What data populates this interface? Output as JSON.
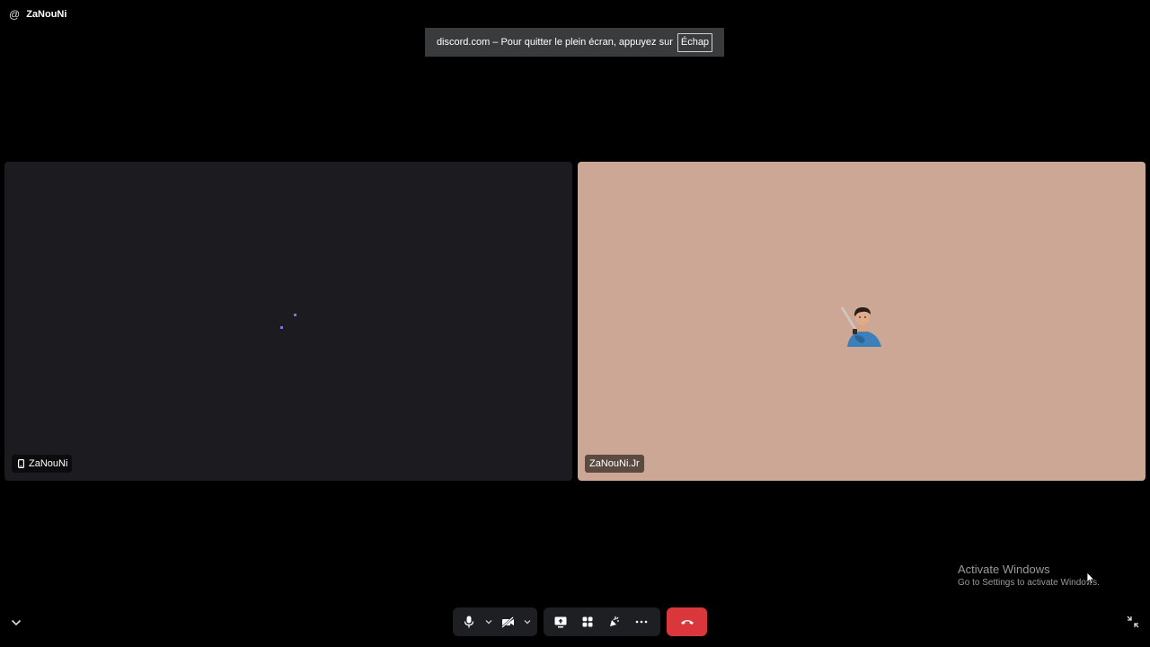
{
  "header": {
    "at_icon": "@",
    "channel_name": "ZaNouNi"
  },
  "fullscreen_banner": {
    "message": "discord.com – Pour quitter le plein écran, appuyez sur",
    "key": "Échap"
  },
  "tiles": [
    {
      "name": "ZaNouNi",
      "icon": "phone-icon",
      "background": "#1c1c20",
      "state": "loading"
    },
    {
      "name": "ZaNouNi.Jr",
      "icon": "avatar",
      "background": "#cca795"
    }
  ],
  "watermark": {
    "title": "Activate Windows",
    "subtitle": "Go to Settings to activate Windows."
  },
  "controls": {
    "av_group": [
      "microphone-icon",
      "chevron-down-icon",
      "camera-off-icon",
      "chevron-down-icon"
    ],
    "action_group": [
      "screen-share-icon",
      "activities-icon",
      "soundboard-icon",
      "more-icon"
    ],
    "end_call": "hang-up-icon"
  },
  "colors": {
    "background": "#000000",
    "tile_dark": "#1c1c20",
    "tile_peach": "#cca795",
    "loader": "#7b74e8",
    "end_call": "#da373c",
    "control_bg": "#1e1f22"
  }
}
